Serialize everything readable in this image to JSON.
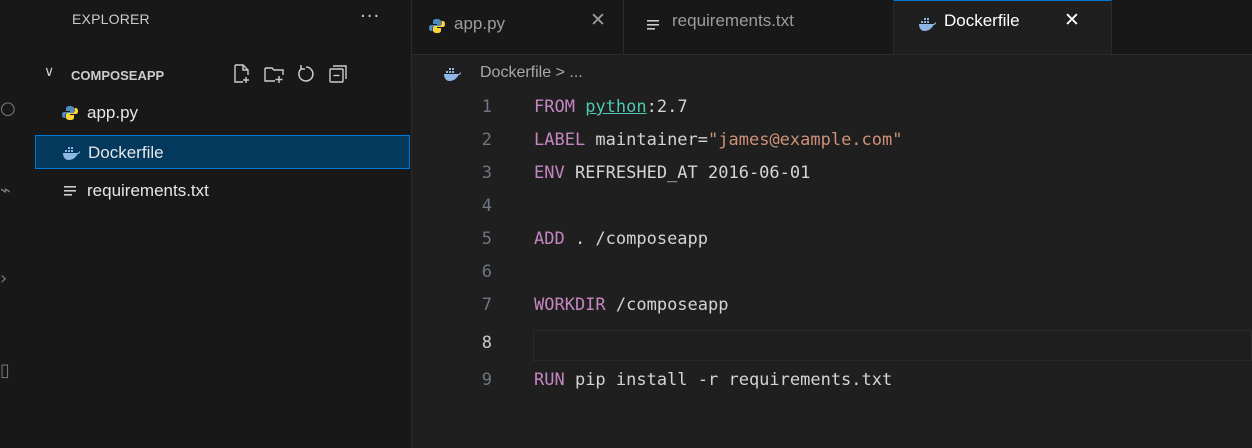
{
  "colors": {
    "accent": "#0078d4",
    "docker_icon": "#8fb7e6",
    "python_blue": "#4b8bbe",
    "python_yellow": "#ffd43b"
  },
  "sidebar": {
    "title": "EXPLORER",
    "more_glyph": "···",
    "section": {
      "chevron": "∨",
      "title": "COMPOSEAPP"
    },
    "actions": [
      "new-file-icon",
      "new-folder-icon",
      "refresh-icon",
      "collapse-all-icon"
    ],
    "files": [
      {
        "name": "app.py",
        "icon": "python-icon"
      },
      {
        "name": "Dockerfile",
        "icon": "docker-icon",
        "selected": true
      },
      {
        "name": "requirements.txt",
        "icon": "text-lines-icon"
      }
    ]
  },
  "tabs": [
    {
      "label": "app.py",
      "icon": "python-icon",
      "close": "✕"
    },
    {
      "label": "requirements.txt",
      "icon": "text-lines-icon"
    },
    {
      "label": "Dockerfile",
      "icon": "docker-icon",
      "close": "✕",
      "active": true
    }
  ],
  "breadcrumb": {
    "file": "Dockerfile",
    "sep": ">",
    "rest": "..."
  },
  "editor": {
    "current_line": 8,
    "lines": [
      {
        "n": "1",
        "kw": "FROM",
        "img": "python",
        "rest": ":2.7"
      },
      {
        "n": "2",
        "kw": "LABEL",
        "rest": " maintainer=",
        "str": "\"james@example.com\""
      },
      {
        "n": "3",
        "kw": "ENV",
        "rest": " REFRESHED_AT 2016-06-01"
      },
      {
        "n": "4"
      },
      {
        "n": "5",
        "kw": "ADD",
        "rest": " . /composeapp"
      },
      {
        "n": "6"
      },
      {
        "n": "7",
        "kw": "WORKDIR",
        "rest": " /composeapp"
      },
      {
        "n": "8"
      },
      {
        "n": "9",
        "kw": "RUN",
        "rest": " pip install -r requirements.txt"
      }
    ]
  }
}
